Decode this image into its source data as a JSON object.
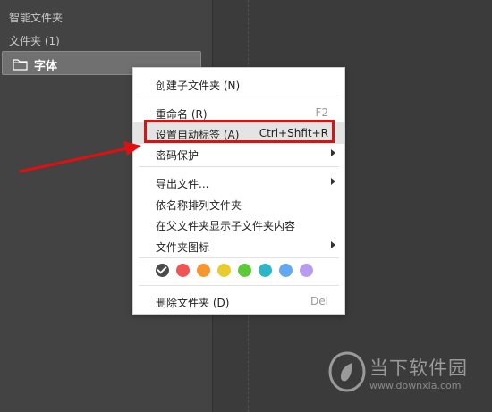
{
  "sidebar": {
    "section_title": "智能文件夹",
    "folders_heading": "文件夹 (1)",
    "folder_item": {
      "name": "字体",
      "icon": "folder-icon"
    }
  },
  "context_menu": {
    "items": [
      {
        "label": "创建子文件夹 (N)",
        "shortcut": ""
      },
      {
        "label": "重命名 (R)",
        "shortcut": "F2"
      },
      {
        "label": "设置自动标签 (A)",
        "shortcut": "Ctrl+Shfit+R",
        "highlighted": true
      },
      {
        "label": "密码保护",
        "submenu": true
      },
      {
        "label": "导出文件...",
        "submenu": true
      },
      {
        "label": "依名称排列文件夹"
      },
      {
        "label": "在父文件夹显示子文件夹内容"
      },
      {
        "label": "文件夹图标",
        "submenu": true
      },
      {
        "label": "删除文件夹 (D)",
        "shortcut": "Del"
      }
    ],
    "color_tags": [
      "#4a4a4a",
      "#f05454",
      "#f5962e",
      "#e8cc2c",
      "#5cc83a",
      "#2cb6c8",
      "#63a8f0",
      "#b89cf2"
    ],
    "selected_color_index": 0
  },
  "annotation": {
    "box_color": "#e01010",
    "arrow_color": "#e01010"
  },
  "watermark": {
    "text": "当下软件园",
    "url": "www.downxia.com"
  }
}
